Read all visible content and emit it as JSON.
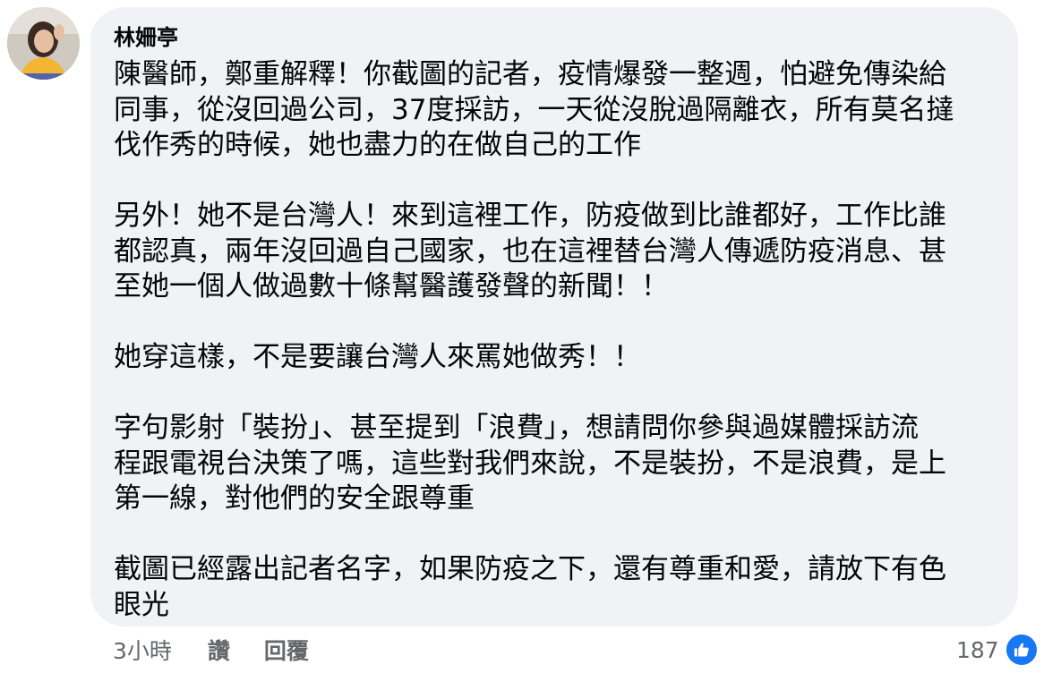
{
  "comment": {
    "author": "林姍亭",
    "paragraphs": [
      [
        "陳醫師，鄭重解釋！你截圖的記者，疫情爆發一整週，怕避免傳染給",
        "同事，從沒回過公司，37度採訪，一天從沒脫過隔離衣，所有莫名撻",
        "伐作秀的時候，她也盡力的在做自己的工作"
      ],
      [
        "另外！她不是台灣人！來到這裡工作，防疫做到比誰都好，工作比誰",
        "都認真，兩年沒回過自己國家，也在這裡替台灣人傳遞防疫消息、甚",
        "至她一個人做過數十條幫醫護發聲的新聞！！"
      ],
      [
        "她穿這樣，不是要讓台灣人來罵她做秀！！"
      ],
      [
        "字句影射「裝扮」、甚至提到「浪費」，想請問你參與過媒體採訪流",
        "程跟電視台決策了嗎，這些對我們來說，不是裝扮，不是浪費，是上",
        "第一線，對他們的安全跟尊重"
      ],
      [
        "截圖已經露出記者名字，如果防疫之下，還有尊重和愛，請放下有色",
        "眼光"
      ]
    ]
  },
  "footer": {
    "time": "3小時",
    "like_label": "讚",
    "reply_label": "回覆"
  },
  "reactions": {
    "count": "187",
    "icon": "thumbs-up-icon",
    "color": "#1877f2"
  }
}
